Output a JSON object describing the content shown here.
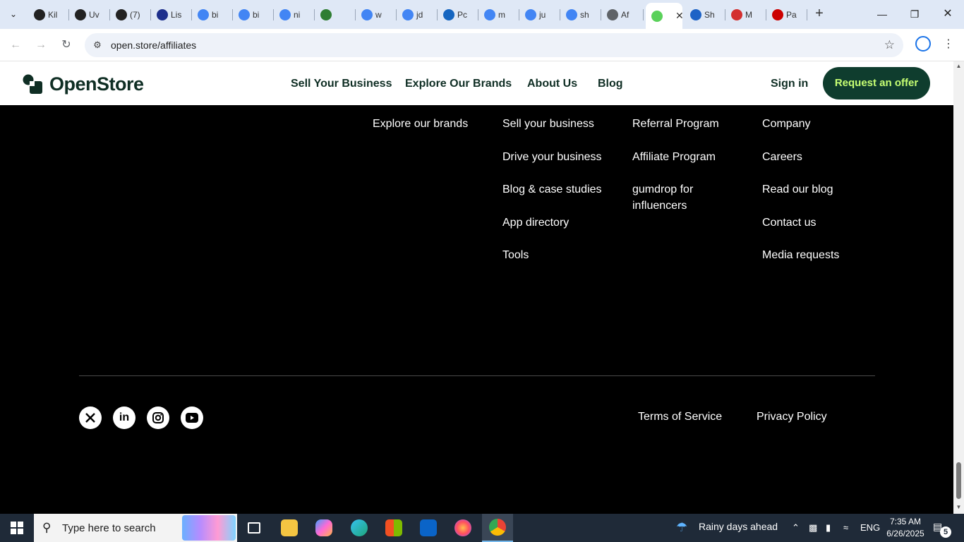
{
  "browser": {
    "tabs": [
      {
        "label": "Kil",
        "icon": "openai-icon",
        "color": "#222222"
      },
      {
        "label": "Uv",
        "icon": "openai-icon",
        "color": "#222222"
      },
      {
        "label": "(7)",
        "icon": "quora-icon",
        "color": "#222222"
      },
      {
        "label": "Lis",
        "icon": "ttp-icon",
        "color": "#1d2f8c"
      },
      {
        "label": "bi",
        "icon": "google-icon",
        "color": "#4285f4"
      },
      {
        "label": "bi",
        "icon": "google-icon",
        "color": "#4285f4"
      },
      {
        "label": "ni",
        "icon": "google-icon",
        "color": "#4285f4"
      },
      {
        "label": "",
        "icon": "extension-icons",
        "color": "#2e7d32"
      },
      {
        "label": "w",
        "icon": "google-icon",
        "color": "#4285f4"
      },
      {
        "label": "jd",
        "icon": "google-icon",
        "color": "#4285f4"
      },
      {
        "label": "Pc",
        "icon": "xf-icon",
        "color": "#1565c0"
      },
      {
        "label": "m",
        "icon": "google-icon",
        "color": "#4285f4"
      },
      {
        "label": "ju",
        "icon": "google-icon",
        "color": "#4285f4"
      },
      {
        "label": "sh",
        "icon": "google-icon",
        "color": "#4285f4"
      },
      {
        "label": "Af",
        "icon": "globe-icon",
        "color": "#5f6368"
      },
      {
        "label": "",
        "icon": "openstore-favicon",
        "color": "#5ad15a",
        "active": true
      },
      {
        "label": "Sh",
        "icon": "mail-icon",
        "color": "#1e63c6"
      },
      {
        "label": "M",
        "icon": "sf-icon",
        "color": "#d32f2f"
      },
      {
        "label": "Pa",
        "icon": "target-icon",
        "color": "#cc0000"
      }
    ],
    "url": "open.store/affiliates"
  },
  "header": {
    "logo_text": "OpenStore",
    "nav": [
      "Sell Your Business",
      "Explore Our Brands",
      "About Us",
      "Blog"
    ],
    "sign_in": "Sign in",
    "cta": "Request an offer",
    "brand_dark": "#0f3d2e",
    "brand_lime": "#c6ff73"
  },
  "footer": {
    "col1": [
      "Explore our brands"
    ],
    "col2": [
      "Sell your business",
      "Drive your business",
      "Blog & case studies",
      "App directory",
      "Tools"
    ],
    "col3": [
      "Referral Program",
      "Affiliate Program",
      "gumdrop for influencers"
    ],
    "col4": [
      "Company",
      "Careers",
      "Read our blog",
      "Contact us",
      "Media requests"
    ],
    "social": [
      "x-icon",
      "linkedin-icon",
      "instagram-icon",
      "youtube-icon"
    ],
    "terms": "Terms of Service",
    "privacy": "Privacy Policy"
  },
  "taskbar": {
    "search_placeholder": "Type here to search",
    "weather": "Rainy days ahead",
    "language": "ENG",
    "time": "7:35 AM",
    "date": "6/26/2025",
    "notifications": "5"
  }
}
